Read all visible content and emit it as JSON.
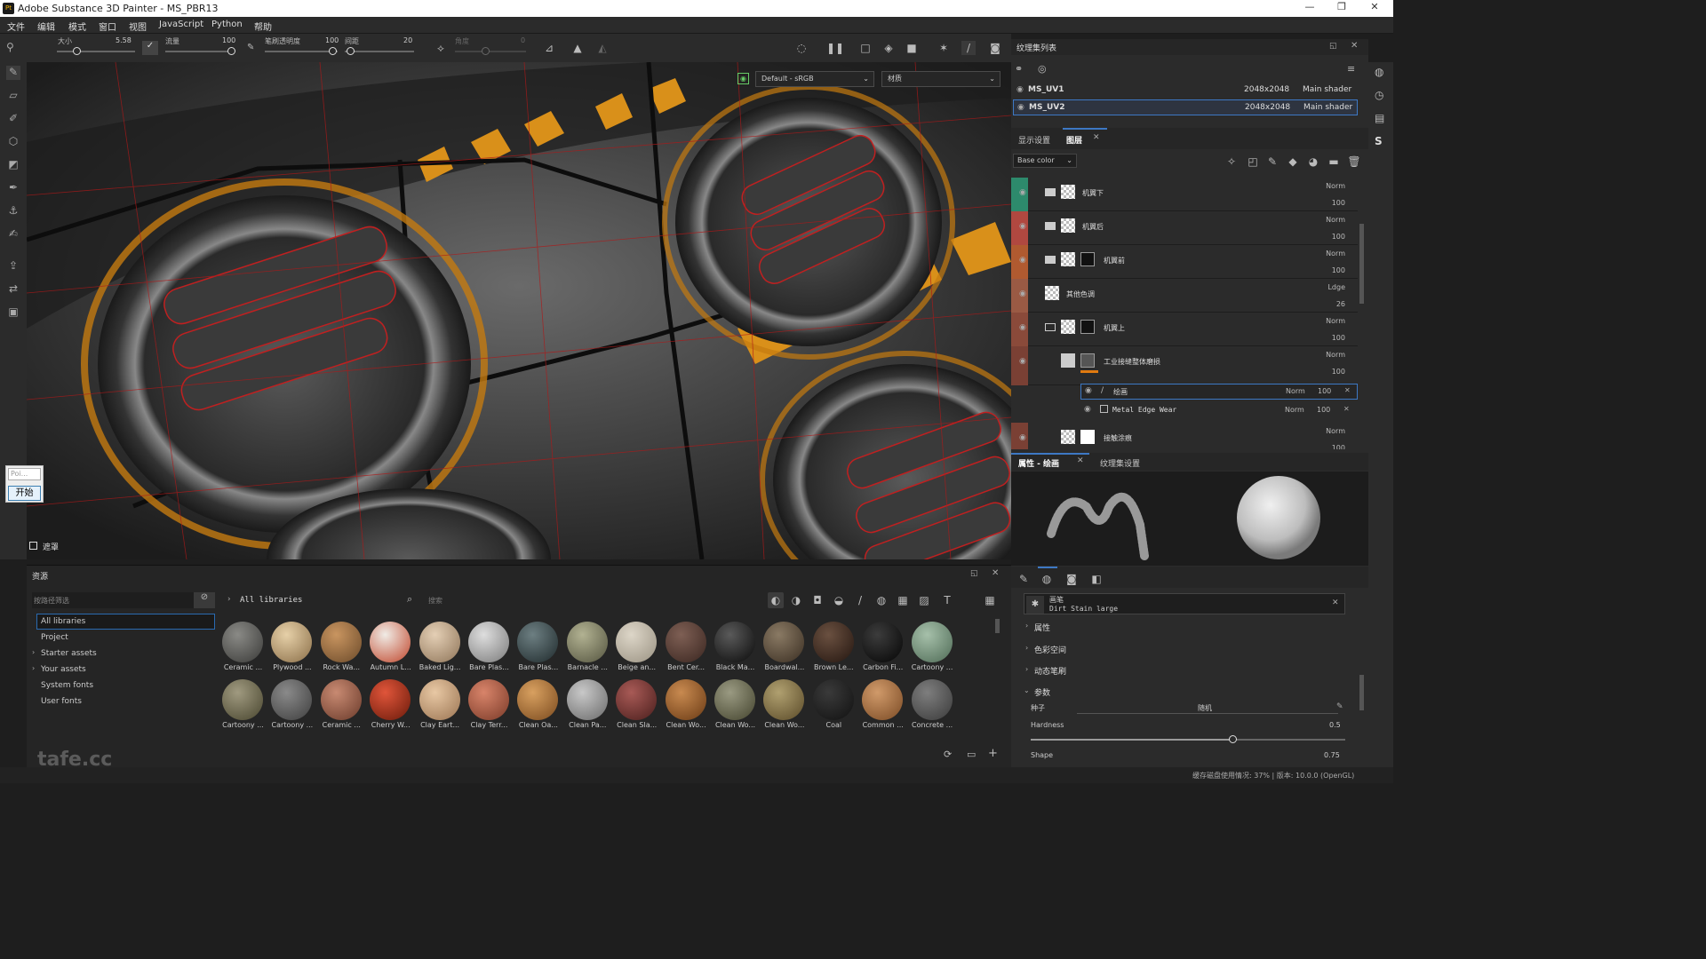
{
  "app": {
    "title": "Adobe Substance 3D Painter - MS_PBR13",
    "logo": "Pt",
    "min": "—",
    "max": "❐",
    "close": "✕"
  },
  "menu": [
    "文件",
    "编辑",
    "模式",
    "窗口",
    "视图",
    "JavaScript",
    "Python",
    "帮助"
  ],
  "toolbar": {
    "size_label": "大小",
    "size_value": "5.58",
    "flow_label": "流量",
    "flow_value": "100",
    "opacity_label": "笔刷透明度",
    "opacity_value": "100",
    "spacing_label": "间距",
    "spacing_value": "20",
    "angle_label": "角度",
    "angle_value": "0"
  },
  "viewport": {
    "colorspace": "Default - sRGB",
    "channel": "材质",
    "mask_label": "遮罩"
  },
  "start_widget": {
    "placeholder": "Poi...",
    "button": "开始"
  },
  "assets": {
    "panel_title": "资源",
    "filter_placeholder": "按路径筛选",
    "search_placeholder": "搜索",
    "breadcrumb": "All libraries",
    "sidebar": [
      "All libraries",
      "Project",
      "Starter assets",
      "Your assets",
      "System fonts",
      "User fonts"
    ],
    "row1": [
      {
        "name": "Ceramic ...",
        "c1": "#8a8a86",
        "c2": "#3a3a38"
      },
      {
        "name": "Plywood ...",
        "c1": "#e6d0a8",
        "c2": "#8a6e48"
      },
      {
        "name": "Rock Wa...",
        "c1": "#c99560",
        "c2": "#6b4a2a"
      },
      {
        "name": "Autumn L...",
        "c1": "#f0ece6",
        "c2": "#c0452a"
      },
      {
        "name": "Baked Lig...",
        "c1": "#e4cfb5",
        "c2": "#8e7458"
      },
      {
        "name": "Bare Plas...",
        "c1": "#dedede",
        "c2": "#7a7a7a"
      },
      {
        "name": "Bare Plas...",
        "c1": "#6d7f82",
        "c2": "#1f2a2c"
      },
      {
        "name": "Barnacle ...",
        "c1": "#b2b292",
        "c2": "#54543f"
      },
      {
        "name": "Beige an...",
        "c1": "#ddd6c8",
        "c2": "#9a9282"
      },
      {
        "name": "Bent Cer...",
        "c1": "#7e5f54",
        "c2": "#3a2620"
      },
      {
        "name": "Black Ma...",
        "c1": "#5a5a5a",
        "c2": "#0a0a0a"
      },
      {
        "name": "Boardwal...",
        "c1": "#8a7a64",
        "c2": "#3a2e22"
      },
      {
        "name": "Brown Le...",
        "c1": "#6a5040",
        "c2": "#241610"
      },
      {
        "name": "Carbon Fi...",
        "c1": "#3c3c3c",
        "c2": "#050505"
      },
      {
        "name": "Cartoony ...",
        "c1": "#a6c0aa",
        "c2": "#4e6a55"
      }
    ],
    "row2": [
      {
        "name": "Cartoony ...",
        "c1": "#a09a80",
        "c2": "#48452e"
      },
      {
        "name": "Cartoony ...",
        "c1": "#8a8a8a",
        "c2": "#3e3e3e"
      },
      {
        "name": "Ceramic ...",
        "c1": "#c88a72",
        "c2": "#6a3a2a"
      },
      {
        "name": "Cherry W...",
        "c1": "#e0553a",
        "c2": "#6a1a0a"
      },
      {
        "name": "Clay Eart...",
        "c1": "#e8c8a4",
        "c2": "#9a7452"
      },
      {
        "name": "Clay Terr...",
        "c1": "#d8846a",
        "c2": "#7a3a28"
      },
      {
        "name": "Clean Oa...",
        "c1": "#d8a060",
        "c2": "#7a4a1e"
      },
      {
        "name": "Clean Pa...",
        "c1": "#c8c8c8",
        "c2": "#6a6a6a"
      },
      {
        "name": "Clean Sla...",
        "c1": "#a85a56",
        "c2": "#4a1e1c"
      },
      {
        "name": "Clean Wo...",
        "c1": "#c88a50",
        "c2": "#6a3a14"
      },
      {
        "name": "Clean Wo...",
        "c1": "#9a9a82",
        "c2": "#44442e"
      },
      {
        "name": "Clean Wo...",
        "c1": "#b0a070",
        "c2": "#5a4a28"
      },
      {
        "name": "Coal",
        "c1": "#3a3a3a",
        "c2": "#111111"
      },
      {
        "name": "Common ...",
        "c1": "#d09a6a",
        "c2": "#7a4a24"
      },
      {
        "name": "Concrete ...",
        "c1": "#7e7e7e",
        "c2": "#3a3a3a"
      }
    ]
  },
  "texture_sets": {
    "title": "纹理集列表",
    "items": [
      {
        "name": "MS_UV1",
        "res": "2048x2048",
        "shader": "Main shader"
      },
      {
        "name": "MS_UV2",
        "res": "2048x2048",
        "shader": "Main shader"
      }
    ]
  },
  "layers": {
    "tab_display": "显示设置",
    "tab_layers": "图层",
    "channel": "Base color",
    "items": [
      {
        "name": "机翼下",
        "blend": "Norm",
        "opacity": "100",
        "color": "#2d8a6c"
      },
      {
        "name": "机翼后",
        "blend": "Norm",
        "opacity": "100",
        "color": "#b04840"
      },
      {
        "name": "机翼前",
        "blend": "Norm",
        "opacity": "100",
        "color": "#b05a30"
      },
      {
        "name": "其他色调",
        "blend": "Ldge",
        "opacity": "26",
        "color": "#9a5a44"
      },
      {
        "name": "机翼上",
        "blend": "Norm",
        "opacity": "100",
        "color": "#8a4a3a"
      },
      {
        "name": "工业接缝整体磨损",
        "blend": "Norm",
        "opacity": "100",
        "color": "#7a4034"
      },
      {
        "name": "接触涂痕",
        "blend": "Norm",
        "opacity": "100",
        "color": "#7a4034"
      }
    ],
    "sub": [
      {
        "name": "绘画",
        "blend": "Norm",
        "opacity": "100"
      },
      {
        "name": "Metal Edge Wear",
        "blend": "Norm",
        "opacity": "100"
      }
    ]
  },
  "properties": {
    "tab_props": "属性 - 绘画",
    "tab_ts": "纹理集设置",
    "brush_name": "画笔",
    "brush_sub": "Dirt Stain large",
    "sections": [
      "属性",
      "色彩空间",
      "动态笔刷",
      "参数"
    ],
    "seed_label": "种子",
    "seed_value": "随机",
    "hardness_label": "Hardness",
    "hardness_value": "0.5",
    "hardness_level": 0.64,
    "shape_label": "Shape",
    "shape_value": "0.75"
  },
  "status": {
    "text": "缓存磁盘使用情况:  37%  |  版本: 10.0.0 (OpenGL)",
    "watermark": "tafe.cc"
  }
}
